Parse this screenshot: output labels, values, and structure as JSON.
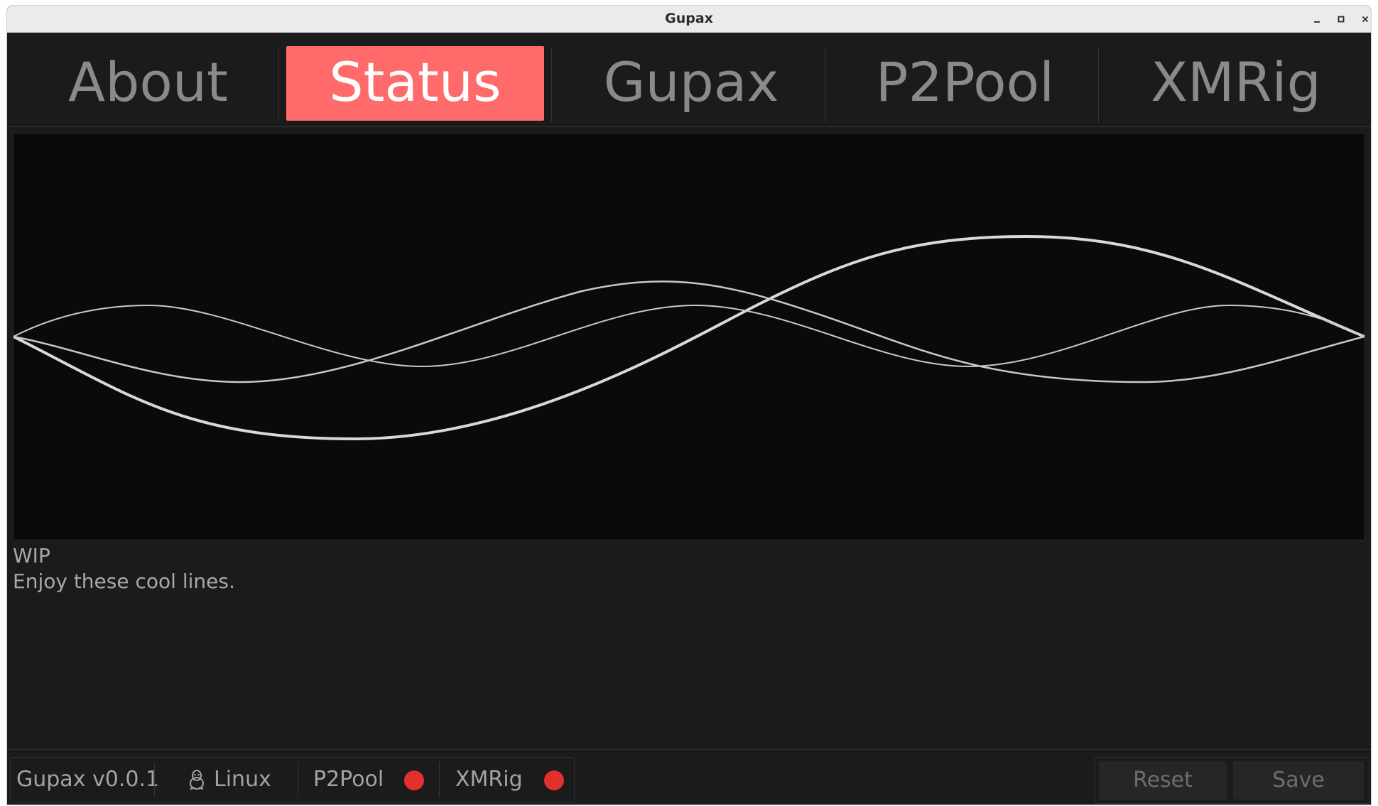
{
  "window": {
    "title": "Gupax"
  },
  "tabs": [
    {
      "label": "About",
      "active": false
    },
    {
      "label": "Status",
      "active": true
    },
    {
      "label": "Gupax",
      "active": false
    },
    {
      "label": "P2Pool",
      "active": false
    },
    {
      "label": "XMRig",
      "active": false
    }
  ],
  "main": {
    "line1": "WIP",
    "line2": "Enjoy these cool lines."
  },
  "statusbar": {
    "version": "Gupax v0.0.1",
    "os": "Linux",
    "os_icon": "tux-penguin-icon",
    "p2pool_label": "P2Pool",
    "p2pool_status_color": "#e3302f",
    "xmrig_label": "XMRig",
    "xmrig_status_color": "#e3302f"
  },
  "buttons": {
    "reset_label": "Reset",
    "save_label": "Save"
  },
  "colors": {
    "accent": "#ff6b6b",
    "background": "#1b1b1b",
    "canvas": "#0a0a0a",
    "line": "#d9d9d9"
  }
}
